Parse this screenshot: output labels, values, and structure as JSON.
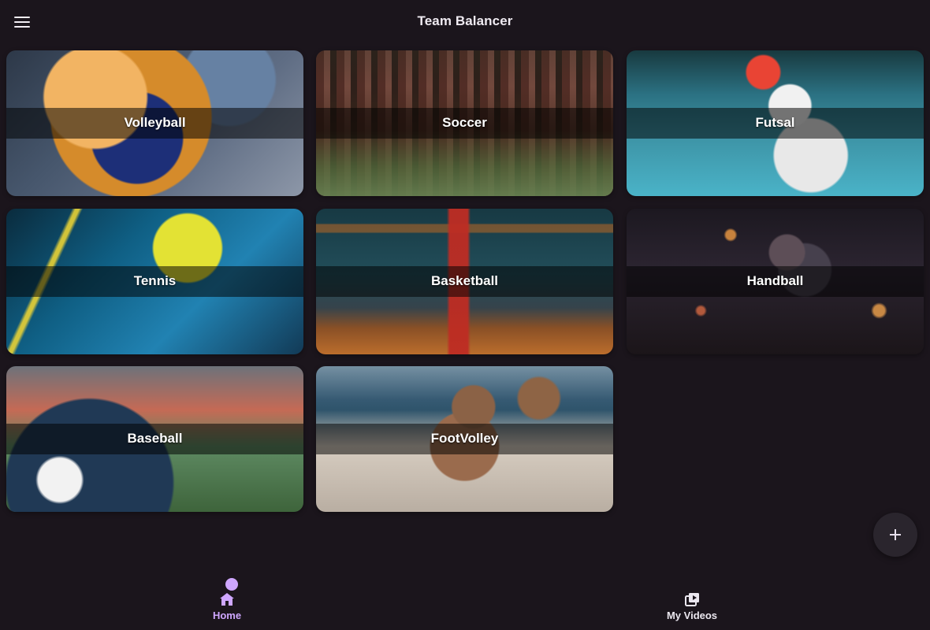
{
  "app": {
    "title": "Team Balancer"
  },
  "cards": [
    {
      "label": "Volleyball"
    },
    {
      "label": "Soccer"
    },
    {
      "label": "Futsal"
    },
    {
      "label": "Tennis"
    },
    {
      "label": "Basketball"
    },
    {
      "label": "Handball"
    },
    {
      "label": "Baseball"
    },
    {
      "label": "FootVolley"
    }
  ],
  "navigation": {
    "home_label": "Home",
    "videos_label": "My Videos"
  },
  "icons": {
    "menu": "menu-icon",
    "add": "plus-icon",
    "home": "home-icon",
    "videos": "video-library-icon"
  },
  "colors": {
    "background": "#1b151c",
    "accent": "#cfa7ff",
    "text": "#ffffff"
  }
}
